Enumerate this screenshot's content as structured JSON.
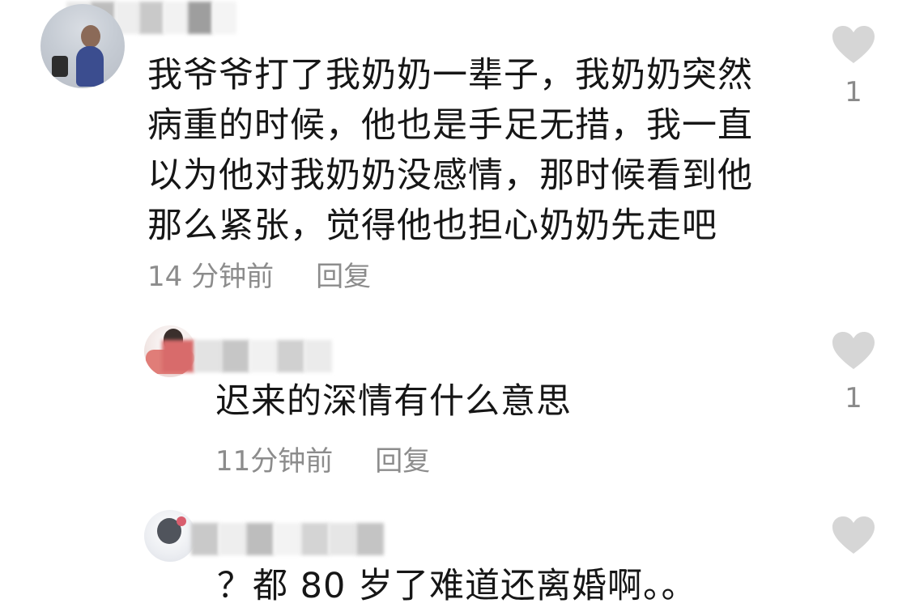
{
  "comments": [
    {
      "text": "我爷爷打了我奶奶一辈子，我奶奶突然病重的时候，他也是手足无措，我一直以为他对我奶奶没感情，那时候看到他那么紧张，觉得他也担心奶奶先走吧",
      "time": "14 分钟前",
      "reply_label": "回复",
      "like_count": "1"
    },
    {
      "text": "迟来的深情有什么意思",
      "time": "11分钟前",
      "reply_label": "回复",
      "like_count": "1"
    },
    {
      "text": "？都 80 岁了难道还离婚啊。。"
    }
  ],
  "icons": {
    "like": "heart-icon"
  },
  "colors": {
    "text": "#161616",
    "meta": "#8c8c8c",
    "heart": "#d6d6d6"
  }
}
